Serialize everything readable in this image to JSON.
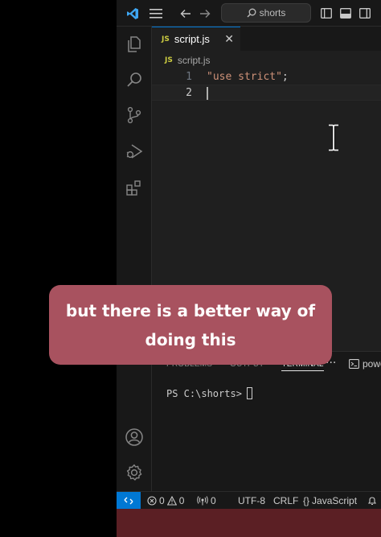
{
  "titlebar": {
    "search_text": "shorts"
  },
  "tab": {
    "badge": "JS",
    "filename": "script.js",
    "close": "✕"
  },
  "breadcrumb": {
    "badge": "JS",
    "filename": "script.js"
  },
  "editor": {
    "lines": [
      {
        "number": "1",
        "code": "\"use strict\"",
        "suffix": ";"
      },
      {
        "number": "2",
        "code": "",
        "suffix": ""
      }
    ]
  },
  "panel": {
    "tabs": [
      "PROBLEMS",
      "OUTPUT",
      "TERMINAL"
    ],
    "active_tab": "TERMINAL",
    "more": "···",
    "shell": "powe",
    "prompt": "PS C:\\shorts>"
  },
  "statusbar": {
    "errors": "0",
    "warnings": "0",
    "ports": "0",
    "encoding": "UTF-8",
    "eol": "CRLF",
    "lang_braces": "{}",
    "language": "JavaScript"
  },
  "caption": {
    "text": "but there is a better way of doing this"
  },
  "colors": {
    "accent": "#0078d4",
    "caption_bg": "#a8525f",
    "string": "#ce9178",
    "js_badge": "#cbcb41"
  }
}
